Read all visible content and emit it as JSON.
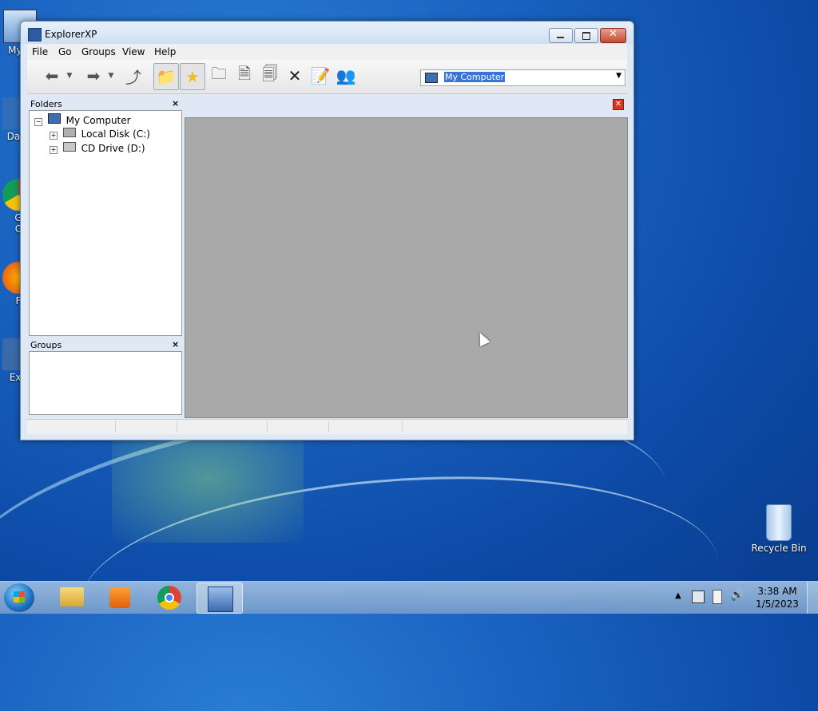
{
  "window": {
    "title": "ExplorerXP",
    "menu": [
      "File",
      "Go",
      "Groups",
      "View",
      "Help"
    ],
    "address": "My Computer"
  },
  "folders_panel": {
    "title": "Folders",
    "tree": [
      "My Computer",
      "Local Disk (C:)",
      "CD Drive (D:)"
    ]
  },
  "groups_panel": {
    "title": "Groups"
  },
  "desktop": {
    "icons": [
      "My C",
      "Data",
      "G",
      "C",
      "F",
      "Exp",
      "Recycle Bin"
    ]
  },
  "taskbar": {
    "time": "3:38 AM",
    "date": "1/5/2023"
  },
  "colors": {
    "desktop_blue": "#1a63c0",
    "content_gray": "#a9a9a9",
    "selection": "#3875d7"
  }
}
